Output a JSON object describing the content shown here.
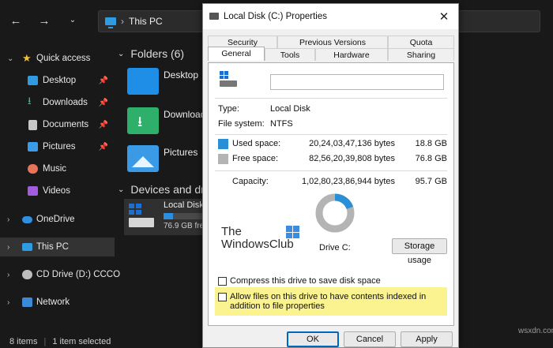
{
  "explorer": {
    "address": {
      "crumb": "This PC"
    },
    "nav_icons": [
      "back-arrow-icon",
      "forward-arrow-icon",
      "chevron-down-icon",
      "up-arrow-icon"
    ],
    "sidebar": {
      "quick_access": "Quick access",
      "items": [
        {
          "label": "Desktop",
          "icon": "desktop-icon",
          "pinned": true
        },
        {
          "label": "Downloads",
          "icon": "download-icon",
          "pinned": true
        },
        {
          "label": "Documents",
          "icon": "documents-icon",
          "pinned": true
        },
        {
          "label": "Pictures",
          "icon": "pictures-icon",
          "pinned": true
        },
        {
          "label": "Music",
          "icon": "music-icon",
          "pinned": false
        },
        {
          "label": "Videos",
          "icon": "videos-icon",
          "pinned": false
        }
      ],
      "onedrive": "OneDrive",
      "this_pc": "This PC",
      "cd_drive": "CD Drive (D:) CCCO",
      "network": "Network"
    },
    "content": {
      "folders_header": "Folders (6)",
      "folders": [
        {
          "label": "Desktop"
        },
        {
          "label": "Download"
        },
        {
          "label": "Pictures"
        }
      ],
      "devices_header": "Devices and driv",
      "drive": {
        "label": "Local Disk",
        "free": "76.9 GB fre",
        "used_fraction": 0.2
      }
    },
    "status": {
      "items": "8 items",
      "selected": "1 item selected"
    }
  },
  "dialog": {
    "title": "Local Disk (C:) Properties",
    "tabs_row1": [
      "Security",
      "Previous Versions",
      "Quota"
    ],
    "tabs_row2": [
      "General",
      "Tools",
      "Hardware",
      "Sharing"
    ],
    "active_tab": "General",
    "name_value": "",
    "type_label": "Type:",
    "type_value": "Local Disk",
    "fs_label": "File system:",
    "fs_value": "NTFS",
    "used_label": "Used space:",
    "used_bytes": "20,24,03,47,136 bytes",
    "used_gb": "18.8 GB",
    "free_label": "Free space:",
    "free_bytes": "82,56,20,39,808 bytes",
    "free_gb": "76.8 GB",
    "capacity_label": "Capacity:",
    "capacity_bytes": "1,02,80,23,86,944 bytes",
    "capacity_gb": "95.7 GB",
    "drive_label": "Drive C:",
    "storage_usage_btn": "Storage usage",
    "compress_label": "Compress this drive to save disk space",
    "index_label": "Allow files on this drive to have contents indexed in addition to file properties",
    "ok_btn": "OK",
    "cancel_btn": "Cancel",
    "apply_btn": "Apply",
    "used_color": "#2a8fd4",
    "free_color": "#b4b4b4",
    "used_fraction": 0.196
  },
  "watermark": {
    "line1": "The",
    "line2": "WindowsClub"
  },
  "corner_mark": "wsxdn.com"
}
